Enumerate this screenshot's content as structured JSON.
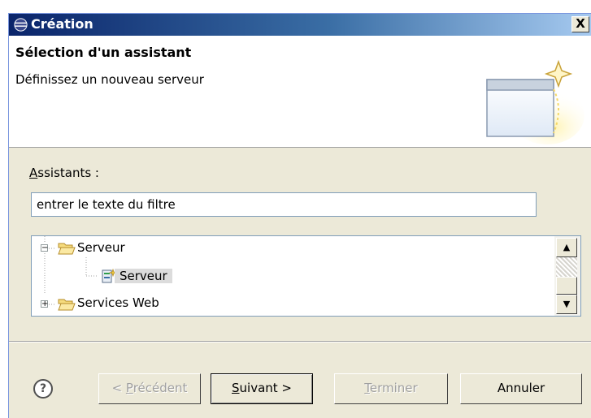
{
  "window": {
    "title": "Création",
    "close_label": "X"
  },
  "header": {
    "title": "Sélection d'un assistant",
    "description": "Définissez un nouveau serveur"
  },
  "wizards": {
    "label_mnemonic": "A",
    "label_rest": "ssistants :",
    "filter_placeholder": "entrer le texte du filtre",
    "tree": [
      {
        "label": "Serveur",
        "expanded": true,
        "children": [
          {
            "label": "Serveur",
            "selected": true
          }
        ]
      },
      {
        "label": "Services Web",
        "expanded": false
      }
    ]
  },
  "buttons": {
    "help": "?",
    "previous": {
      "prefix": "< ",
      "mnemonic": "P",
      "rest": "récédent"
    },
    "next": {
      "mnemonic": "S",
      "rest": "uivant >"
    },
    "finish": {
      "mnemonic": "T",
      "rest": "erminer"
    },
    "cancel": "Annuler"
  },
  "colors": {
    "titlebar_start": "#0a246a",
    "titlebar_end": "#a6caf0",
    "dialog_bg": "#ece9d8",
    "selection_bg": "#dcdcdc"
  }
}
